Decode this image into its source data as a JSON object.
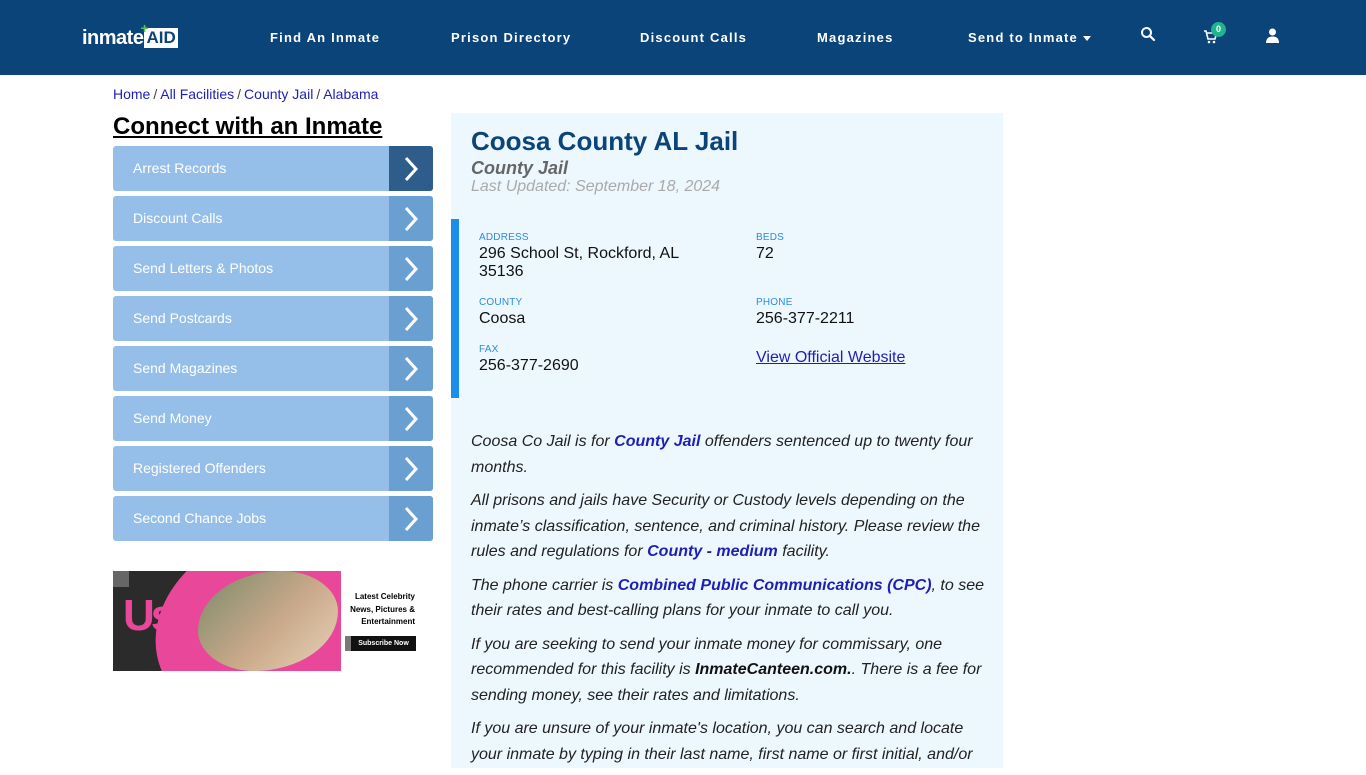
{
  "header": {
    "logo": {
      "text_main": "inmate",
      "text_accent": "AID",
      "plus": "+"
    },
    "nav": [
      {
        "label": "Find An Inmate"
      },
      {
        "label": "Prison Directory"
      },
      {
        "label": "Discount Calls"
      },
      {
        "label": "Magazines"
      },
      {
        "label": "Send to Inmate",
        "has_dropdown": true
      }
    ],
    "icons": {
      "search": "search-icon",
      "cart": "cart-icon",
      "user": "user-icon"
    },
    "cart_count": "0",
    "colors": {
      "bar": "#0b4479",
      "badge": "#1fb38e"
    }
  },
  "breadcrumb": {
    "items": [
      "Home",
      "All Facilities",
      "County Jail",
      "Alabama"
    ],
    "separator": "/"
  },
  "sidebar": {
    "title": "Connect with an Inmate",
    "items": [
      {
        "label": "Arrest Records"
      },
      {
        "label": "Discount Calls"
      },
      {
        "label": "Send Letters & Photos"
      },
      {
        "label": "Send Postcards"
      },
      {
        "label": "Send Magazines"
      },
      {
        "label": "Send Money"
      },
      {
        "label": "Registered Offenders"
      },
      {
        "label": "Second Chance Jobs"
      }
    ],
    "ad": {
      "brand": "Us",
      "tagline": "Latest Celebrity News, Pictures & Entertainment",
      "cta": "Subscribe Now"
    }
  },
  "facility": {
    "name": "Coosa County AL Jail",
    "type": "County Jail",
    "last_updated": "Last Updated: September 18, 2024",
    "address_label": "ADDRESS",
    "address_line1": "296 School St, Rockford, AL",
    "address_line2": "35136",
    "beds_label": "BEDS",
    "beds": "72",
    "county_label": "COUNTY",
    "county": "Coosa",
    "phone_label": "PHONE",
    "phone": "256-377-2211",
    "fax_label": "FAX",
    "fax": "256-377-2690",
    "website_link": "View Official Website"
  },
  "description": {
    "p1": {
      "a": "Coosa Co Jail is for ",
      "link": "County Jail",
      "b": " offenders sentenced up to twenty four months."
    },
    "p2": {
      "a": "All prisons and jails have Security or Custody levels depending on the inmate’s classification, sentence, and criminal history. Please review the rules and regulations for ",
      "link": "County - medium",
      "b": " facility."
    },
    "p3": {
      "a": "The phone carrier is ",
      "link": "Combined Public Communications (CPC)",
      "b": ", to see their rates and best-calling plans for your inmate to call you."
    },
    "p4": {
      "a": "If you are seeking to send your inmate money for commissary, one recommended for this facility is ",
      "bold": "InmateCanteen.com.",
      "b": ". There is a fee for sending money, see their rates and limitations."
    },
    "p5": {
      "a": "If you are unsure of your inmate's location, you can search and locate your inmate by typing in their last name, first name or first initial, and/or"
    }
  }
}
